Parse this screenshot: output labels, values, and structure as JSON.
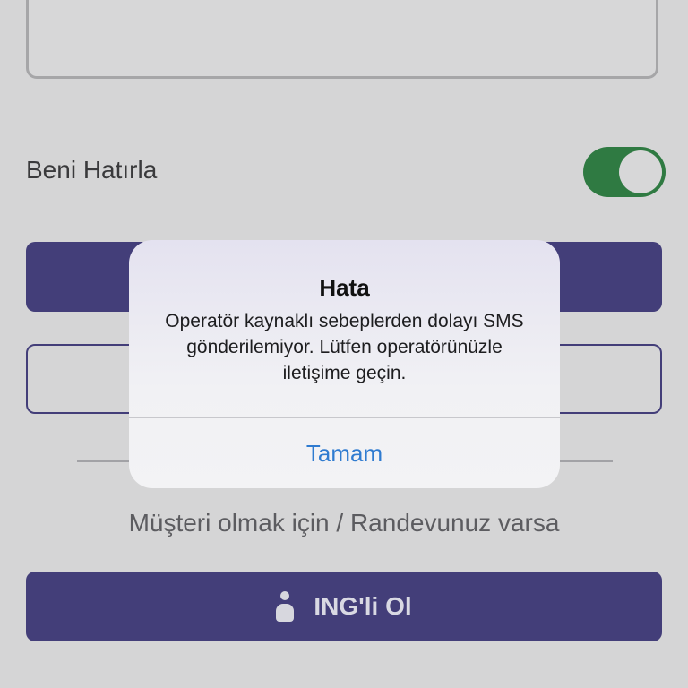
{
  "form": {
    "remember_me_label": "Beni Hatırla",
    "remember_me_on": true,
    "customer_prompt": "Müşteri olmak için / Randevunuz varsa",
    "become_customer_label": "ING'li Ol"
  },
  "alert": {
    "title": "Hata",
    "message": "Operatör kaynaklı sebeplerden dolayı SMS gönderilemiyor. Lütfen operatörünüzle iletişime geçin.",
    "ok_label": "Tamam"
  },
  "colors": {
    "toggle_on": "#2f7a42",
    "primary_button": "#433e79",
    "alert_link": "#2f7bd0"
  },
  "icons": {
    "become_customer_icon": "person-icon"
  }
}
